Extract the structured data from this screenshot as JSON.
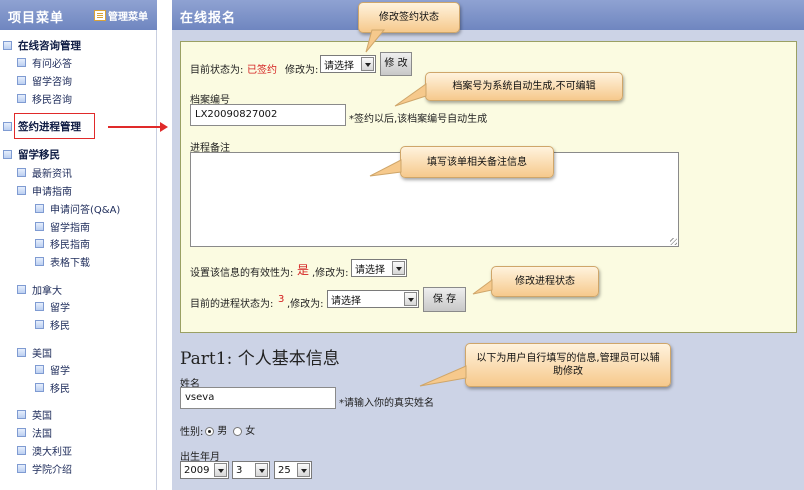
{
  "sidebar": {
    "title": "项目菜单",
    "manage_label": "管理菜单",
    "items": [
      {
        "label": "在线咨询管理"
      },
      {
        "label": "有问必答"
      },
      {
        "label": "留学咨询"
      },
      {
        "label": "移民咨询"
      },
      {
        "label": "签约进程管理"
      },
      {
        "label": "留学移民"
      },
      {
        "label": "最新资讯"
      },
      {
        "label": "申请指南"
      },
      {
        "label": "申请问答(Q&A)"
      },
      {
        "label": "留学指南"
      },
      {
        "label": "移民指南"
      },
      {
        "label": "表格下载"
      },
      {
        "label": "加拿大"
      },
      {
        "label": "留学"
      },
      {
        "label": "移民"
      },
      {
        "label": "美国"
      },
      {
        "label": "留学"
      },
      {
        "label": "移民"
      },
      {
        "label": "英国"
      },
      {
        "label": "法国"
      },
      {
        "label": "澳大利亚"
      },
      {
        "label": "学院介绍"
      }
    ]
  },
  "main": {
    "title": "在线报名",
    "status": {
      "label": "目前状态为:",
      "value": "已签约",
      "change_label": "修改为:",
      "select_value": "请选择",
      "button": "修 改"
    },
    "file_no": {
      "label": "档案编号",
      "value": "LX20090827002",
      "hint": "*签约以后,该档案编号自动生成"
    },
    "notes": {
      "label": "进程备注"
    },
    "validity": {
      "label": "设置该信息的有效性为:",
      "value": "是",
      "change_label": ",修改为:",
      "select_value": "请选择"
    },
    "progress": {
      "label": "目前的进程状态为:",
      "value": "3",
      "change_label": ",修改为:",
      "select_value": "请选择",
      "button": "保 存"
    },
    "part1": {
      "title": "Part1: 个人基本信息",
      "name_label": "姓名",
      "name_value": "vseva",
      "name_hint": "*请输入你的真实姓名",
      "gender_label": "性别:",
      "male": "男",
      "female": "女",
      "birth_label": "出生年月",
      "year": "2009",
      "month": "3",
      "day": "25"
    }
  },
  "callouts": {
    "status": "修改签约状态",
    "file_no": "档案号为系统自动生成,不可编辑",
    "notes": "填写该单相关备注信息",
    "progress": "修改进程状态",
    "user_info": "以下为用户自行填写的信息,管理员可以辅助修改"
  }
}
